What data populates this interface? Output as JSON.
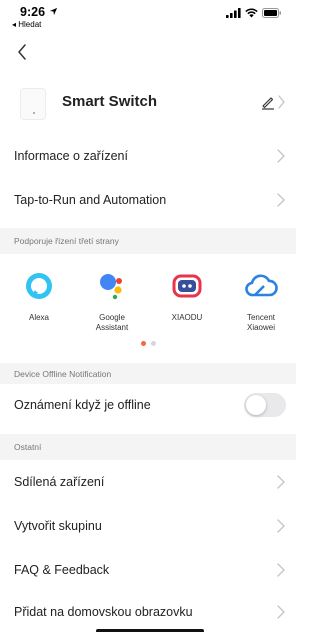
{
  "status_bar": {
    "time": "9:26",
    "back_app": "◂ Hledat"
  },
  "device": {
    "name": "Smart Switch"
  },
  "rows": {
    "device_info": "Informace o zařízení",
    "automation": "Tap-to-Run and Automation"
  },
  "third_party": {
    "section_title": "Podporuje řízení třetí strany",
    "assistants": [
      {
        "label": "Alexa",
        "icon": "alexa-icon",
        "color": "#31c4f3"
      },
      {
        "label": "Google\nAssistant",
        "icon": "google-assistant-icon",
        "color": "#4285f4"
      },
      {
        "label": "XIAODU",
        "icon": "xiaodu-icon",
        "color": "#e8334a"
      },
      {
        "label": "Tencent\nXiaowei",
        "icon": "tencent-xiaowei-icon",
        "color": "#2b82e3"
      }
    ],
    "pager": {
      "pages": 2,
      "active": 1,
      "active_color": "#f26a3d"
    }
  },
  "offline": {
    "section_title": "Device Offline Notification",
    "label": "Oznámení když je offline",
    "enabled": false
  },
  "other": {
    "section_title": "Ostatní",
    "shared_devices": "Sdílená zařízení",
    "create_group": "Vytvořit skupinu",
    "faq": "FAQ & Feedback",
    "add_home": "Přidat na domovskou obrazovku"
  }
}
